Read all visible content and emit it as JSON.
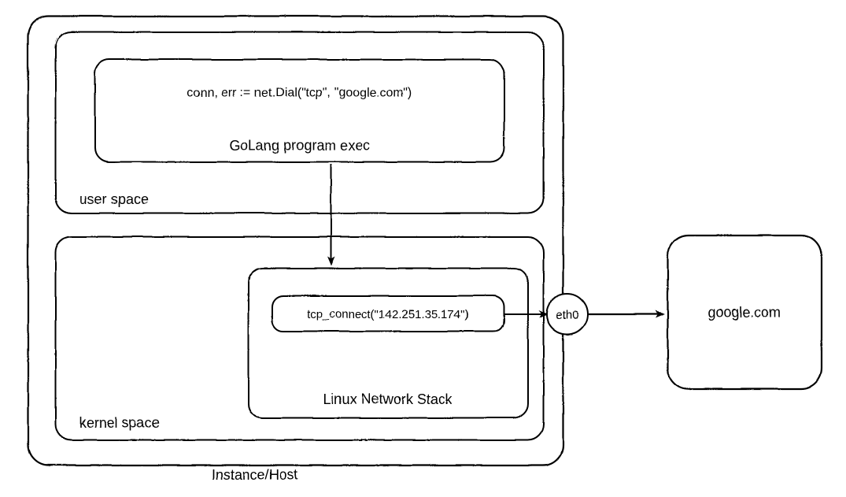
{
  "instance_host_label": "Instance/Host",
  "user_space": {
    "label": "user space",
    "program_label": "GoLang program exec",
    "code_line": "conn, err := net.Dial(\"tcp\", \"google.com\")"
  },
  "kernel_space": {
    "label": "kernel space",
    "stack_label": "Linux Network Stack",
    "tcp_connect": "tcp_connect(\"142.251.35.174\")"
  },
  "nic_label": "eth0",
  "remote_label": "google.com"
}
